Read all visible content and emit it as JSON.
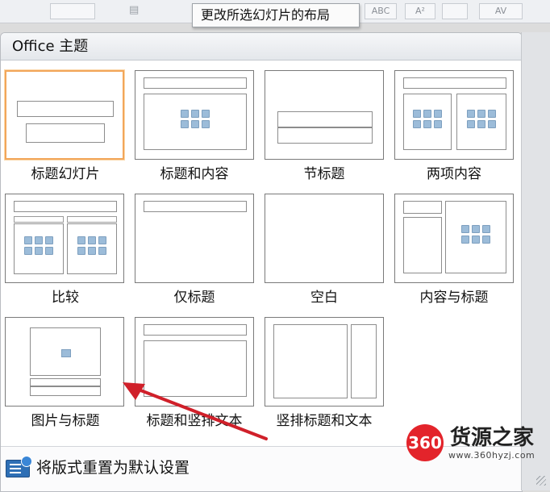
{
  "tooltip": {
    "text": "更改所选幻灯片的布局"
  },
  "ribbon": {
    "abc": "ABC",
    "a2": "A²",
    "av": "AV"
  },
  "gallery": {
    "header": "Office 主题",
    "layouts": [
      {
        "label": "标题幻灯片",
        "selected": true
      },
      {
        "label": "标题和内容",
        "selected": false
      },
      {
        "label": "节标题",
        "selected": false
      },
      {
        "label": "两项内容",
        "selected": false
      },
      {
        "label": "比较",
        "selected": false
      },
      {
        "label": "仅标题",
        "selected": false
      },
      {
        "label": "空白",
        "selected": false
      },
      {
        "label": "内容与标题",
        "selected": false
      },
      {
        "label": "图片与标题",
        "selected": false
      },
      {
        "label": "标题和竖排文本",
        "selected": false
      },
      {
        "label": "竖排标题和文本",
        "selected": false
      }
    ],
    "footer": {
      "reset_label": "将版式重置为默认设置"
    }
  },
  "watermark": {
    "badge": "360",
    "name": "货源之家",
    "url": "www.360hyzj.com"
  },
  "colors": {
    "selected_border": "#f2a65a",
    "annotation_arrow": "#d0202a",
    "icon_fill": "#9cbcd9"
  }
}
